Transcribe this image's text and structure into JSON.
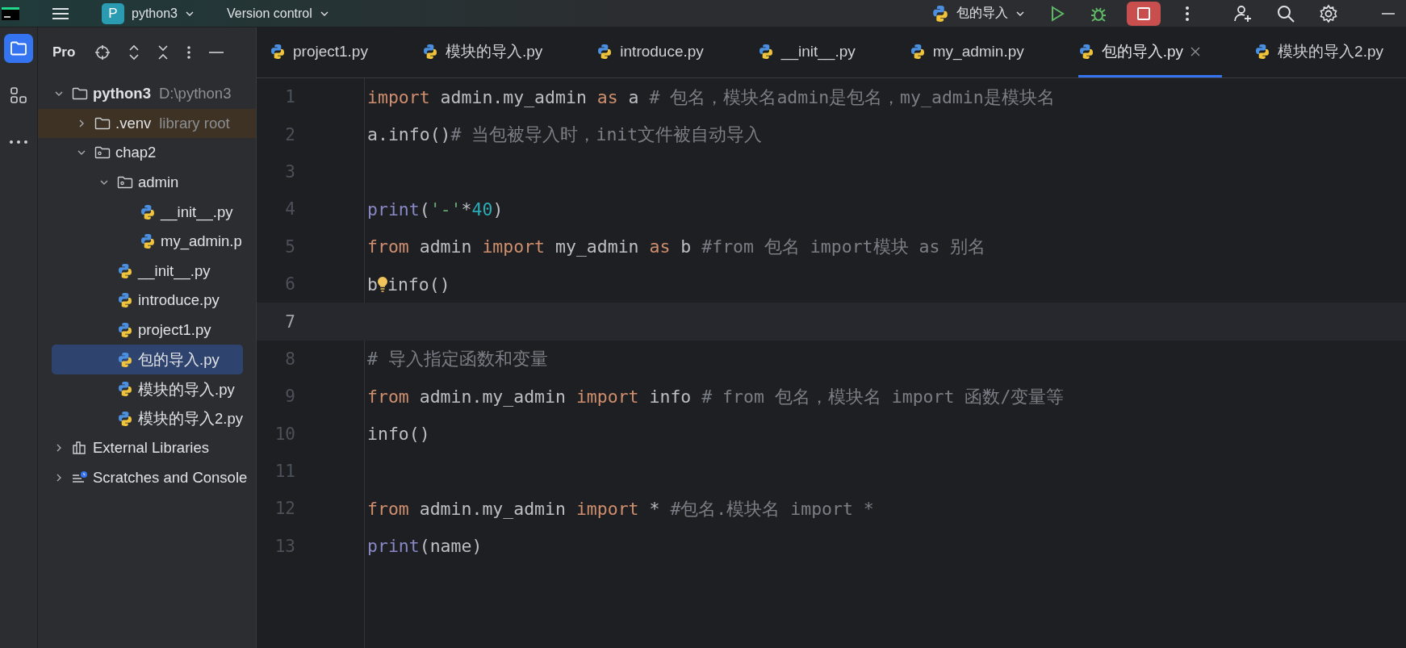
{
  "top_bar": {
    "project_letter": "P",
    "project_name": "python3",
    "vcs": "Version control",
    "run_config": "包的导入"
  },
  "left_strip": [
    {
      "kind": "project",
      "selected": true
    },
    {
      "kind": "structure",
      "selected": false
    },
    {
      "kind": "more",
      "selected": false
    }
  ],
  "sidebar": {
    "title": "Pro",
    "tree": [
      {
        "name": "python3",
        "hint": "D:\\python3",
        "kind": "folder",
        "expanded": true,
        "selected": false,
        "highlighted": false,
        "children": [
          {
            "name": ".venv",
            "hint": "library root",
            "kind": "folder",
            "expanded": false,
            "selected": false,
            "highlighted": true
          },
          {
            "name": "chap2",
            "kind": "package",
            "expanded": true,
            "selected": false,
            "highlighted": false,
            "children": [
              {
                "name": "admin",
                "kind": "package",
                "expanded": true,
                "selected": false,
                "highlighted": false,
                "children": [
                  {
                    "name": "__init__.py",
                    "kind": "python",
                    "selected": false,
                    "highlighted": false
                  },
                  {
                    "name": "my_admin.p",
                    "kind": "python",
                    "selected": false,
                    "highlighted": false
                  }
                ]
              },
              {
                "name": "__init__.py",
                "kind": "python",
                "selected": false,
                "highlighted": false
              },
              {
                "name": "introduce.py",
                "kind": "python",
                "selected": false,
                "highlighted": false
              },
              {
                "name": "project1.py",
                "kind": "python",
                "selected": false,
                "highlighted": false
              },
              {
                "name": "包的导入.py",
                "kind": "python",
                "selected": true,
                "highlighted": false
              },
              {
                "name": "模块的导入.py",
                "kind": "python",
                "selected": false,
                "highlighted": false
              },
              {
                "name": "模块的导入2.py",
                "kind": "python",
                "selected": false,
                "highlighted": false
              }
            ]
          }
        ]
      },
      {
        "name": "External Libraries",
        "kind": "libraries",
        "expanded": false,
        "selected": false,
        "highlighted": false
      },
      {
        "name": "Scratches and Console",
        "kind": "scratches",
        "expanded": false,
        "selected": false,
        "highlighted": false
      }
    ]
  },
  "tabs": [
    {
      "label": "project1.py",
      "selected": false
    },
    {
      "label": "模块的导入.py",
      "selected": false
    },
    {
      "label": "introduce.py",
      "selected": false
    },
    {
      "label": "__init__.py",
      "selected": false
    },
    {
      "label": "my_admin.py",
      "selected": false
    },
    {
      "label": "包的导入.py",
      "selected": true
    },
    {
      "label": "模块的导入2.py",
      "selected": false
    }
  ],
  "editor": {
    "lines": [
      {
        "number": "1",
        "current": false,
        "tokens": [
          {
            "kind": "keyword",
            "text": "import"
          },
          {
            "kind": "plain",
            "text": " admin.my_admin "
          },
          {
            "kind": "keyword",
            "text": "as"
          },
          {
            "kind": "plain",
            "text": " a "
          },
          {
            "kind": "comment",
            "text": "# 包名，模块名admin是包名，my_admin是模块名"
          }
        ]
      },
      {
        "number": "2",
        "current": false,
        "tokens": [
          {
            "kind": "plain",
            "text": "a.info()"
          },
          {
            "kind": "comment",
            "text": "# 当包被导入时，init文件被自动导入"
          }
        ]
      },
      {
        "number": "3",
        "current": false
      },
      {
        "number": "4",
        "current": false,
        "tokens": [
          {
            "kind": "builtin",
            "text": "print"
          },
          {
            "kind": "plain",
            "text": "("
          },
          {
            "kind": "string",
            "text": "'-'"
          },
          {
            "kind": "plain",
            "text": "*"
          },
          {
            "kind": "number",
            "text": "40"
          },
          {
            "kind": "plain",
            "text": ")"
          }
        ]
      },
      {
        "number": "5",
        "current": false,
        "tokens": [
          {
            "kind": "keyword",
            "text": "from"
          },
          {
            "kind": "plain",
            "text": " admin "
          },
          {
            "kind": "keyword",
            "text": "import"
          },
          {
            "kind": "plain",
            "text": " my_admin "
          },
          {
            "kind": "keyword",
            "text": "as"
          },
          {
            "kind": "plain",
            "text": " b "
          },
          {
            "kind": "comment",
            "text": "#from 包名 import模块 as 别名"
          }
        ]
      },
      {
        "number": "6",
        "current": false,
        "tokens": [
          {
            "kind": "plain",
            "text": "b"
          },
          {
            "kind": "bulb"
          },
          {
            "kind": "plain",
            "text": "info()"
          }
        ]
      },
      {
        "number": "7",
        "current": true
      },
      {
        "number": "8",
        "current": false,
        "tokens": [
          {
            "kind": "comment",
            "text": "# 导入指定函数和变量"
          }
        ]
      },
      {
        "number": "9",
        "current": false,
        "tokens": [
          {
            "kind": "keyword",
            "text": "from"
          },
          {
            "kind": "plain",
            "text": " admin.my_admin "
          },
          {
            "kind": "keyword",
            "text": "import"
          },
          {
            "kind": "plain",
            "text": " info "
          },
          {
            "kind": "comment",
            "text": "# from 包名，模块名 import 函数/变量等"
          }
        ]
      },
      {
        "number": "10",
        "current": false,
        "tokens": [
          {
            "kind": "plain",
            "text": "info()"
          }
        ]
      },
      {
        "number": "11",
        "current": false
      },
      {
        "number": "12",
        "current": false,
        "tokens": [
          {
            "kind": "keyword",
            "text": "from"
          },
          {
            "kind": "plain",
            "text": " admin.my_admin "
          },
          {
            "kind": "keyword",
            "text": "import"
          },
          {
            "kind": "plain",
            "text": " * "
          },
          {
            "kind": "comment",
            "text": "#包名.模块名 import *"
          }
        ]
      },
      {
        "number": "13",
        "current": false,
        "tokens": [
          {
            "kind": "builtin",
            "text": "print"
          },
          {
            "kind": "plain",
            "text": "(name)"
          }
        ]
      }
    ]
  }
}
